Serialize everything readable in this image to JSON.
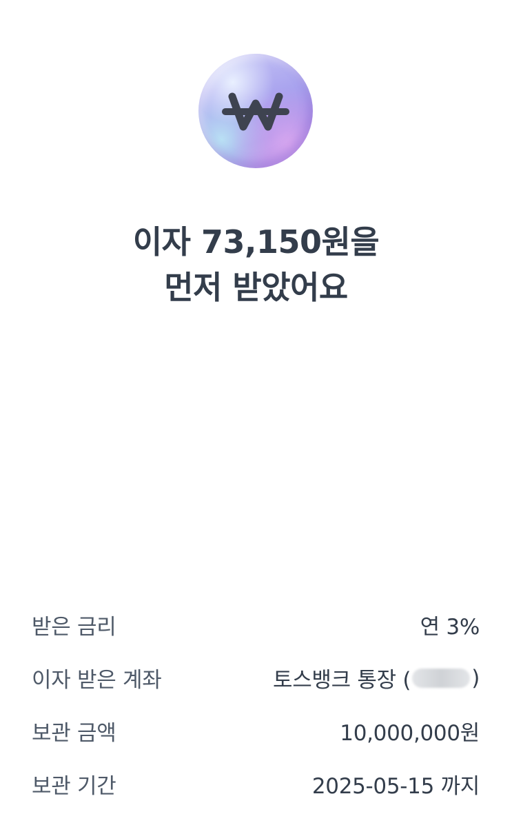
{
  "icon": {
    "name": "won-coin-icon",
    "symbol": "₩"
  },
  "headline": {
    "line1": "이자 73,150원을",
    "line2": "먼저 받았어요"
  },
  "details": {
    "rate": {
      "label": "받은 금리",
      "value": "연 3%"
    },
    "account": {
      "label": "이자 받은 계좌",
      "value_prefix": "토스뱅크 통장 (",
      "value_suffix": ")"
    },
    "amount": {
      "label": "보관 금액",
      "value": "10,000,000원"
    },
    "period": {
      "label": "보관 기간",
      "value": "2025-05-15 까지"
    }
  },
  "colors": {
    "text_primary": "#333d4b",
    "text_secondary": "#4e5968",
    "background": "#ffffff",
    "coin_accent": "#a8a2ee"
  }
}
